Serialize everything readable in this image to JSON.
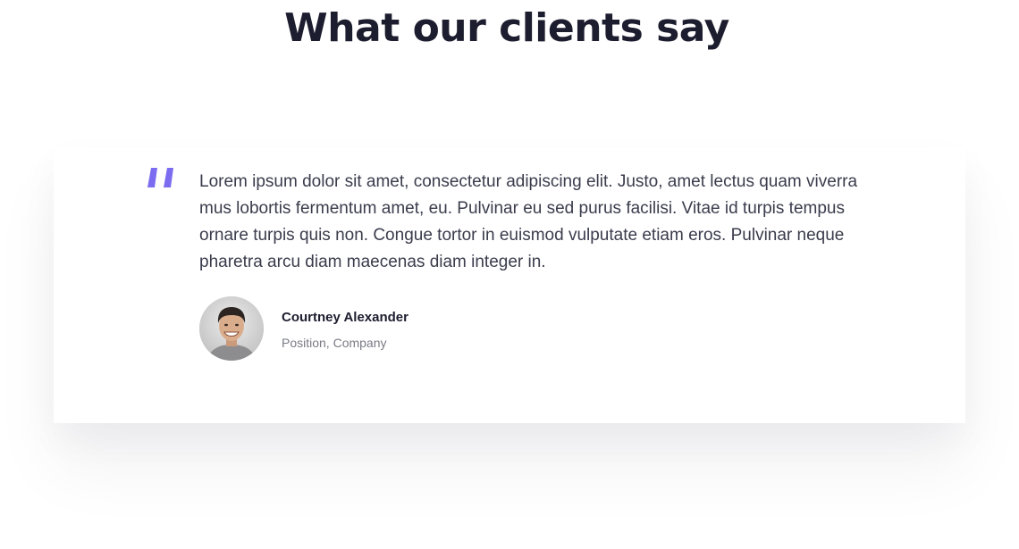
{
  "section": {
    "title": "What our clients say"
  },
  "testimonial": {
    "quote_icon": "quote-mark-icon",
    "text": "Lorem ipsum dolor sit amet, consectetur adipiscing elit. Justo, amet lectus quam viverra mus lobortis fermentum amet, eu. Pulvinar eu sed purus facilisi. Vitae id turpis tempus ornare turpis quis non. Congue tortor in euismod vulputate etiam eros. Pulvinar neque pharetra arcu diam maecenas diam integer in.",
    "author": {
      "name": "Courtney Alexander",
      "role": "Position, Company",
      "avatar": "avatar-photo"
    }
  },
  "colors": {
    "accent": "#7b6cf0",
    "title": "#1c1d2e",
    "body_text": "#3a3c4c",
    "muted_text": "#7a7b86"
  }
}
